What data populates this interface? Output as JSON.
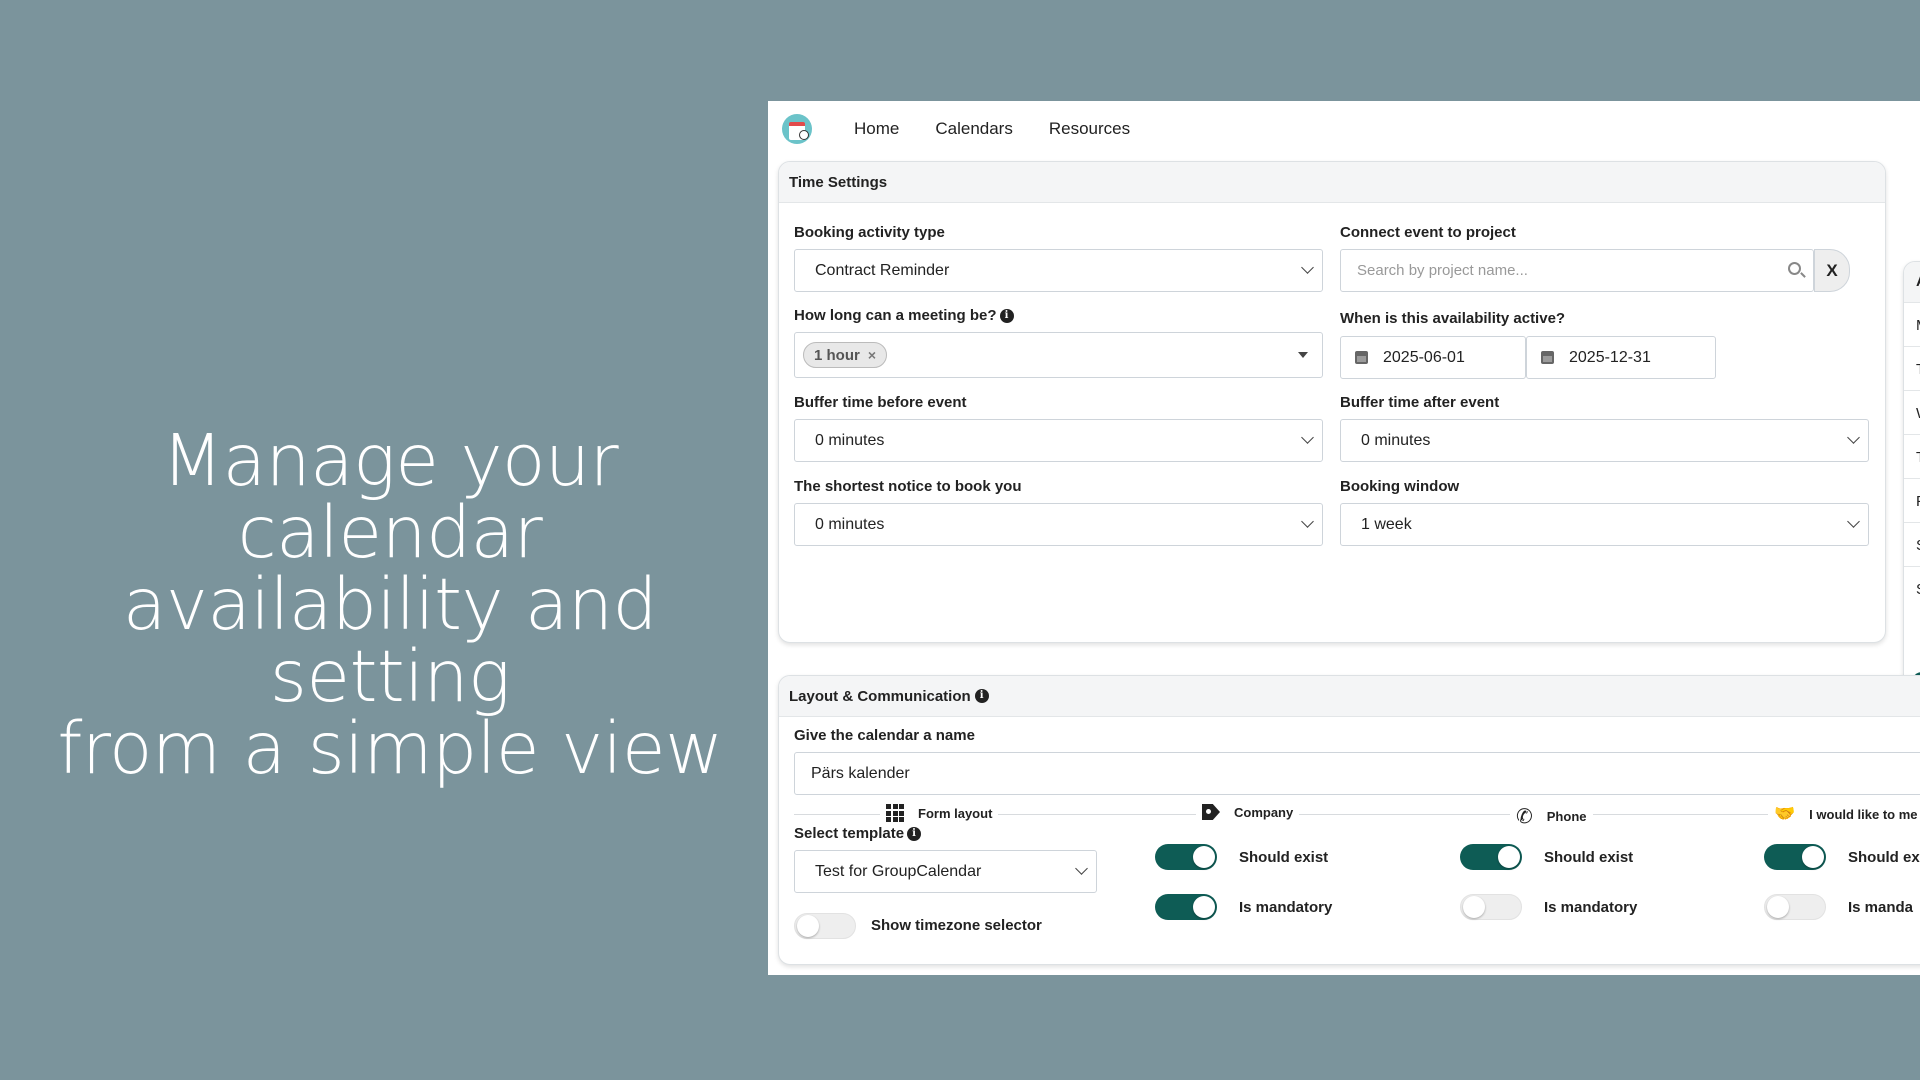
{
  "hero": {
    "line1": "Manage your calendar",
    "line2": "availability and setting",
    "line3": "from a simple view"
  },
  "nav": {
    "items": [
      {
        "label": "Home"
      },
      {
        "label": "Calendars"
      },
      {
        "label": "Resources"
      }
    ]
  },
  "time_settings": {
    "title": "Time Settings",
    "booking_activity_type": {
      "label": "Booking activity type",
      "value": "Contract Reminder"
    },
    "connect_project": {
      "label": "Connect event to project",
      "placeholder": "Search by project name...",
      "clear_label": "X"
    },
    "meeting_length": {
      "label": "How long can a meeting be?",
      "chip": "1 hour",
      "chip_remove": "×"
    },
    "availability_active": {
      "label": "When is this availability active?",
      "start": "2025-06-01",
      "end": "2025-12-31"
    },
    "buffer_before": {
      "label": "Buffer time before event",
      "value": "0 minutes"
    },
    "buffer_after": {
      "label": "Buffer time after event",
      "value": "0 minutes"
    },
    "shortest_notice": {
      "label": "The shortest notice to book you",
      "value": "0 minutes"
    },
    "booking_window": {
      "label": "Booking window",
      "value": "1 week"
    }
  },
  "side_card": {
    "header_letter": "A",
    "rows": [
      "M",
      "T",
      "W",
      "T",
      "F",
      "S",
      "S"
    ]
  },
  "layout_comm": {
    "title": "Layout & Communication",
    "calendar_name": {
      "label": "Give the calendar a name",
      "value": "Pärs kalender"
    },
    "columns": [
      {
        "label": "Form layout",
        "icon": "grid-icon"
      },
      {
        "label": "Company",
        "icon": "tag-icon"
      },
      {
        "label": "Phone",
        "icon": "phone-icon"
      },
      {
        "label": "I would like to me",
        "icon": "handshake-icon"
      }
    ],
    "select_template": {
      "label": "Select template",
      "value": "Test for GroupCalendar"
    },
    "show_timezone": {
      "label": "Show timezone selector",
      "on": false
    },
    "company": {
      "should_exist_label": "Should exist",
      "should_exist": true,
      "mandatory_label": "Is mandatory",
      "mandatory": true
    },
    "phone": {
      "should_exist_label": "Should exist",
      "should_exist": true,
      "mandatory_label": "Is mandatory",
      "mandatory": false
    },
    "meet": {
      "should_exist_label": "Should ex",
      "should_exist": true,
      "mandatory_label": "Is manda",
      "mandatory": false
    }
  },
  "colors": {
    "background": "#7b949c",
    "toggle_on": "#0e5c55",
    "toggle_off": "#eeeeee"
  }
}
